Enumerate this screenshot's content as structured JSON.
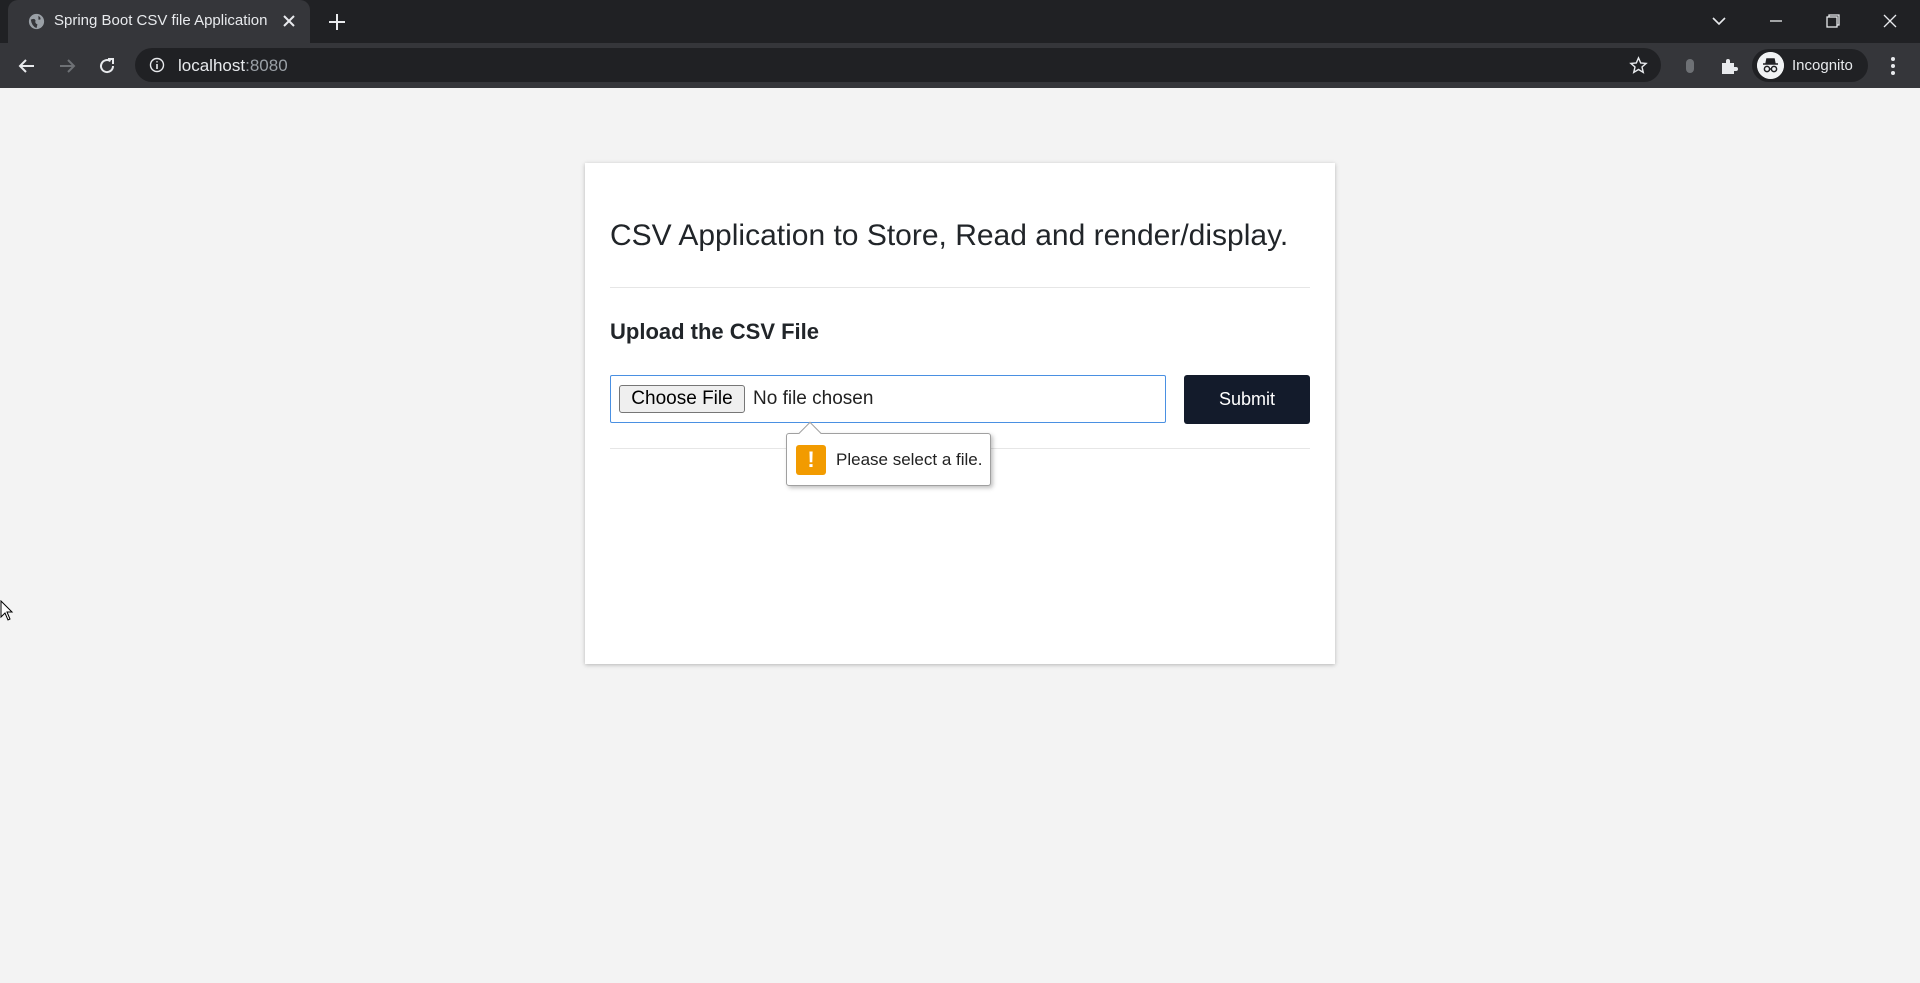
{
  "browser": {
    "tab_title": "Spring Boot CSV file Application",
    "url_host": "localhost",
    "url_port": ":8080",
    "profile_label": "Incognito"
  },
  "page": {
    "title": "CSV Application to Store, Read and render/display.",
    "upload_heading": "Upload the CSV File",
    "choose_file_label": "Choose File",
    "file_status": "No file chosen",
    "submit_label": "Submit",
    "validation_message": "Please select a file."
  },
  "colors": {
    "submit_bg": "#131b2b",
    "warning": "#f29b00",
    "input_focus": "#4a90e2"
  }
}
